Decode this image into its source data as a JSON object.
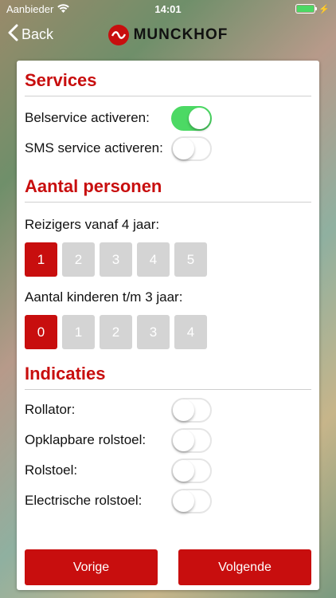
{
  "status_bar": {
    "carrier": "Aanbieder",
    "time": "14:01",
    "battery_level": 1.0
  },
  "nav": {
    "back_label": "Back",
    "logo_text": "MUNCKHOF"
  },
  "services": {
    "title": "Services",
    "items": [
      {
        "label": "Belservice activeren:",
        "on": true
      },
      {
        "label": "SMS service activeren:",
        "on": false
      }
    ]
  },
  "persons": {
    "title": "Aantal personen",
    "travelers": {
      "label": "Reizigers vanaf 4 jaar:",
      "options": [
        "1",
        "2",
        "3",
        "4",
        "5"
      ],
      "selected": "1"
    },
    "children": {
      "label": "Aantal kinderen t/m 3 jaar:",
      "options": [
        "0",
        "1",
        "2",
        "3",
        "4"
      ],
      "selected": "0"
    }
  },
  "indications": {
    "title": "Indicaties",
    "items": [
      {
        "label": "Rollator:",
        "on": false
      },
      {
        "label": "Opklapbare rolstoel:",
        "on": false
      },
      {
        "label": "Rolstoel:",
        "on": false
      },
      {
        "label": "Electrische rolstoel:",
        "on": false
      }
    ]
  },
  "footer": {
    "prev_label": "Vorige",
    "next_label": "Volgende"
  },
  "colors": {
    "accent": "#c80e0e",
    "toggle_on": "#4cd964",
    "inactive": "#d4d4d4"
  }
}
